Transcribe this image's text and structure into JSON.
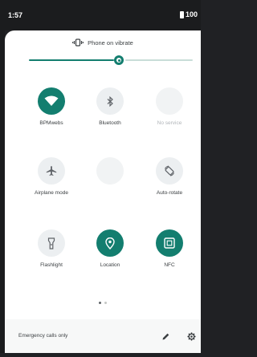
{
  "status_bar": {
    "time": "1:57",
    "battery_text": "100"
  },
  "volume": {
    "mode_label": "Phone on vibrate",
    "level": 0.55
  },
  "tiles": [
    {
      "id": "wifi",
      "label": "BPMwebs",
      "state": "on",
      "icon": "wifi-icon"
    },
    {
      "id": "bluetooth",
      "label": "Bluetooth",
      "state": "off",
      "icon": "bluetooth-icon"
    },
    {
      "id": "no-service",
      "label": "No service",
      "state": "blank",
      "icon": "mobile-data-icon"
    },
    {
      "id": "airplane",
      "label": "Airplane mode",
      "state": "off",
      "icon": "airplane-icon"
    },
    {
      "id": "blank-tile",
      "label": "",
      "state": "blank",
      "icon": ""
    },
    {
      "id": "auto-rotate",
      "label": "Auto-rotate",
      "state": "off",
      "icon": "rotate-icon"
    },
    {
      "id": "flashlight",
      "label": "Flashlight",
      "state": "off",
      "icon": "flashlight-icon"
    },
    {
      "id": "location",
      "label": "Location",
      "state": "on",
      "icon": "location-icon"
    },
    {
      "id": "nfc",
      "label": "NFC",
      "state": "on",
      "icon": "nfc-icon"
    }
  ],
  "page_indicator": {
    "pages": 2,
    "current": 1
  },
  "footer": {
    "text": "Emergency calls only"
  },
  "colors": {
    "accent": "#137e6f",
    "tile_off": "#eceff1",
    "label": "#3c4043"
  }
}
